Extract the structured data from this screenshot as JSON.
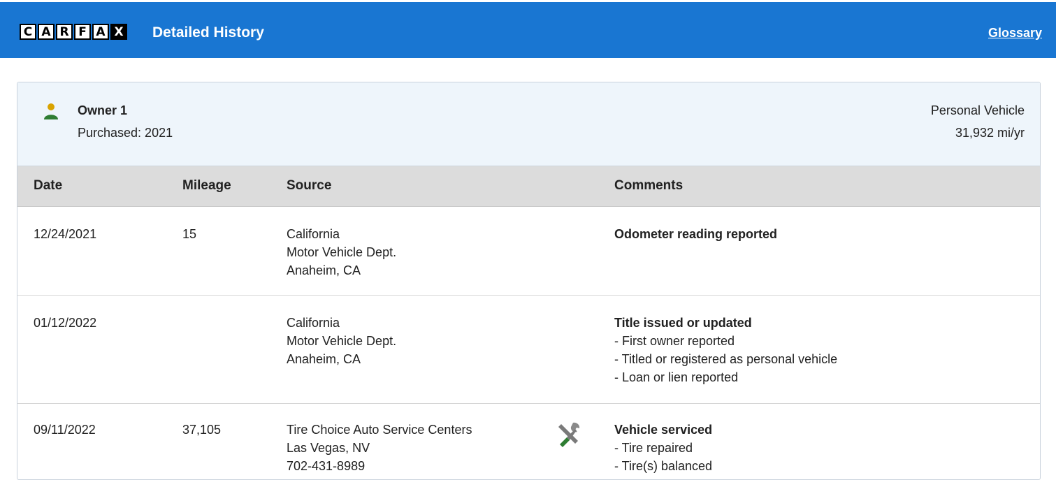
{
  "header": {
    "logo_letters": [
      "C",
      "A",
      "R",
      "F",
      "A",
      "X"
    ],
    "title": "Detailed History",
    "glossary_link": "Glossary",
    "background_color": "#1976d2"
  },
  "owner": {
    "name": "Owner 1",
    "purchased": "Purchased: 2021",
    "vehicle_use": "Personal Vehicle",
    "mileage_rate": "31,932 mi/yr",
    "icon": "person-icon"
  },
  "table": {
    "columns": [
      "Date",
      "Mileage",
      "Source",
      "Comments"
    ],
    "rows": [
      {
        "date": "12/24/2021",
        "mileage": "15",
        "source": [
          "California",
          "Motor Vehicle Dept.",
          "Anaheim, CA"
        ],
        "comment_title": "Odometer reading reported",
        "comment_items": []
      },
      {
        "date": "01/12/2022",
        "mileage": "",
        "source": [
          "California",
          "Motor Vehicle Dept.",
          "Anaheim, CA"
        ],
        "comment_title": "Title issued or updated",
        "comment_items": [
          "- First owner reported",
          "- Titled or registered as personal vehicle",
          "- Loan or lien reported"
        ]
      },
      {
        "date": "09/11/2022",
        "mileage": "37,105",
        "source": [
          "Tire Choice Auto Service Centers",
          "Las Vegas, NV",
          "702-431-8989"
        ],
        "icon": "service-tools-icon",
        "comment_title": "Vehicle serviced",
        "comment_items": [
          "- Tire repaired",
          "- Tire(s) balanced"
        ]
      }
    ]
  }
}
